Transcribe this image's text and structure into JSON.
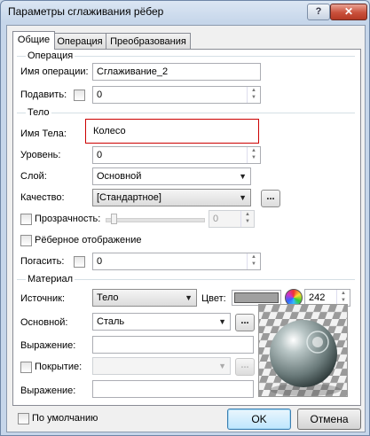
{
  "window": {
    "title": "Параметры сглаживания рёбер",
    "help_label": "?",
    "close_label": "✕"
  },
  "tabs": [
    {
      "label": "Общие",
      "active": true
    },
    {
      "label": "Операция",
      "active": false
    },
    {
      "label": "Преобразования",
      "active": false
    }
  ],
  "groups": {
    "operation": "Операция",
    "body": "Тело",
    "material": "Материал"
  },
  "operation": {
    "name_label": "Имя операции:",
    "name_value": "Сглаживание_2",
    "suppress_label": "Подавить:",
    "suppress_value": "0"
  },
  "body": {
    "name_label": "Имя Тела:",
    "name_value": "Колесо",
    "level_label": "Уровень:",
    "level_value": "0",
    "layer_label": "Слой:",
    "layer_value": "Основной",
    "quality_label": "Качество:",
    "quality_value": "[Стандартное]",
    "transparency_label": "Прозрачность:",
    "transparency_value": "0",
    "transparency_level": 0,
    "edge_display_label": "Рёберное отображение",
    "hide_label": "Погасить:",
    "hide_value": "0",
    "dots": "..."
  },
  "material": {
    "source_label": "Источник:",
    "source_value": "Тело",
    "color_label": "Цвет:",
    "color_hex": "#a0a0a0",
    "color_value": "242",
    "main_label": "Основной:",
    "main_value": "Сталь",
    "expression_label": "Выражение:",
    "expression_value": "",
    "coating_label": "Покрытие:",
    "coating_value": "",
    "expression2_label": "Выражение:",
    "expression2_value": "",
    "dots": "..."
  },
  "footer": {
    "default_label": "По умолчанию",
    "ok_label": "OK",
    "cancel_label": "Отмена"
  }
}
